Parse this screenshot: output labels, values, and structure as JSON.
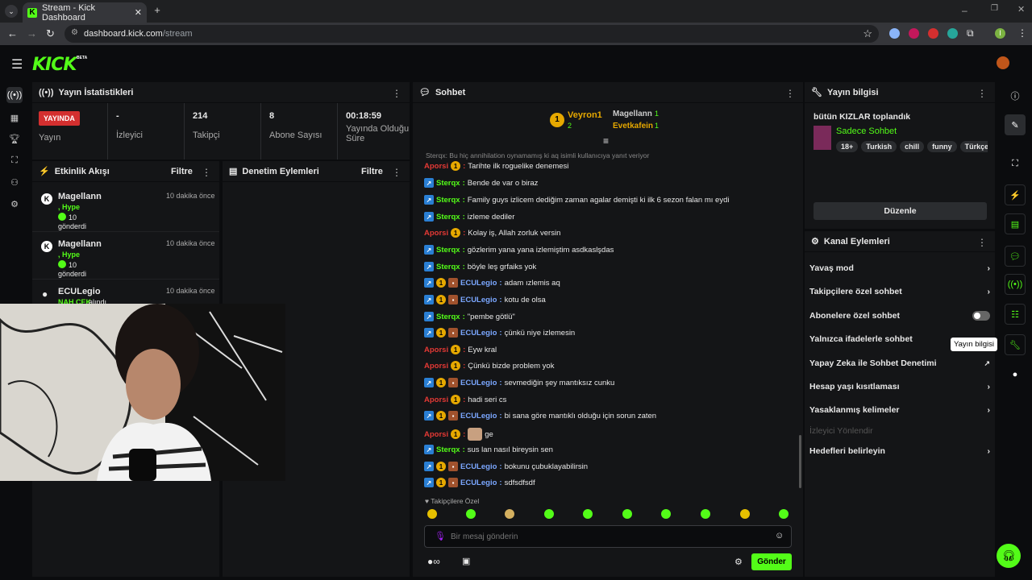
{
  "browser": {
    "tab_title": "Stream - Kick Dashboard",
    "url_host": "dashboard.kick.com",
    "url_path": "/stream",
    "profile_initial": "I"
  },
  "header": {
    "logo": "KICK",
    "beta": "BETA"
  },
  "stats": {
    "title": "Yayın İstatistikleri",
    "live_badge": "YAYINDA",
    "live_label": "Yayın",
    "viewers_value": "-",
    "viewers_label": "İzleyici",
    "followers_value": "214",
    "followers_label": "Takipçi",
    "subs_value": "8",
    "subs_label": "Abone Sayısı",
    "duration_value": "00:18:59",
    "duration_label": "Yayında Olduğu Süre"
  },
  "activity": {
    "title": "Etkinlik Akışı",
    "filter": "Filtre",
    "items": [
      {
        "name": "Magellann",
        "time": "10 dakika önce",
        "kind": ", Hype",
        "amount": "10",
        "sent": "gönderdi"
      },
      {
        "name": "Magellann",
        "time": "10 dakika önce",
        "kind": ", Hype",
        "amount": "10",
        "sent": "gönderdi"
      },
      {
        "name": "ECULegio",
        "time": "10 dakika önce",
        "kind": "NAH CEK",
        "sent": "alındı"
      }
    ]
  },
  "moderation": {
    "title": "Denetim Eylemleri",
    "filter": "Filtre"
  },
  "chat": {
    "title": "Sohbet",
    "top1": "Veyron1",
    "top1_count": "2",
    "top2": "Magellann",
    "top2_count": "1",
    "top3": "Evetkafein",
    "top3_count": "1",
    "reply_note": "Sterqx: Bu hiç annihilation oynamamış ki aq isimli kullanıcıya yanıt veriyor",
    "messages": [
      {
        "user": "Aporsi",
        "text": "Tarihte ilk roguelike denemesi"
      },
      {
        "user": "Sterqx",
        "text": "Bende de var o biraz"
      },
      {
        "user": "Sterqx",
        "text": "Family guys izlicem dediğim zaman agalar demişti ki ilk 6 sezon falan mı eydi"
      },
      {
        "user": "Sterqx",
        "text": "izleme dediler"
      },
      {
        "user": "Aporsi",
        "text": "Kolay iş, Allah zorluk versin"
      },
      {
        "user": "Sterqx",
        "text": "gözlerim yana yana izlemiştim asdkaslşdas"
      },
      {
        "user": "Sterqx",
        "text": "böyle leş grfaiks yok"
      },
      {
        "user": "ECULegio",
        "text": "adam ızlemis aq"
      },
      {
        "user": "ECULegio",
        "text": "kotu de olsa"
      },
      {
        "user": "Sterqx",
        "text": "\"pembe götlü\""
      },
      {
        "user": "ECULegio",
        "text": "çünkü niye izlemesin"
      },
      {
        "user": "Aporsi",
        "text": "Eyw kral"
      },
      {
        "user": "Aporsi",
        "text": "Çünkü bizde problem yok"
      },
      {
        "user": "ECULegio",
        "text": "sevmediğin şey mantıksız cunku"
      },
      {
        "user": "Aporsi",
        "text": "hadi seri cs"
      },
      {
        "user": "ECULegio",
        "text": "bi sana göre mantıklı olduğu için sorun zaten"
      },
      {
        "user": "Aporsi",
        "text": "ge"
      },
      {
        "user": "Sterqx",
        "text": "sus lan nasıl bireysin sen"
      },
      {
        "user": "ECULegio",
        "text": "bokunu çubuklayabilirsin"
      },
      {
        "user": "ECULegio",
        "text": "sdfsdfsdf"
      }
    ],
    "followers_only": "Takipçilere Özel",
    "input_placeholder": "Bir mesaj gönderin",
    "send": "Gönder"
  },
  "stream_info": {
    "title": "Yayın bilgisi",
    "stream_title": "bütün KIZLAR toplandık",
    "category": "Sadece Sohbet",
    "tags": [
      "18+",
      "Turkish",
      "chill",
      "funny",
      "Türkçe"
    ],
    "edit": "Düzenle"
  },
  "channel_actions": {
    "title": "Kanal Eylemleri",
    "slow": "Yavaş mod",
    "followers": "Takipçilere özel sohbet",
    "subs": "Abonelere özel sohbet",
    "emotes": "Yalnızca ifadelerle sohbet",
    "ai": "Yapay Zeka ile Sohbet Denetimi",
    "age": "Hesap yaşı kısıtlaması",
    "banned": "Yasaklanmış kelimeler",
    "redirect": "İzleyici Yönlendir",
    "goals": "Hedefleri belirleyin"
  },
  "tooltip": "Yayın bilgisi"
}
